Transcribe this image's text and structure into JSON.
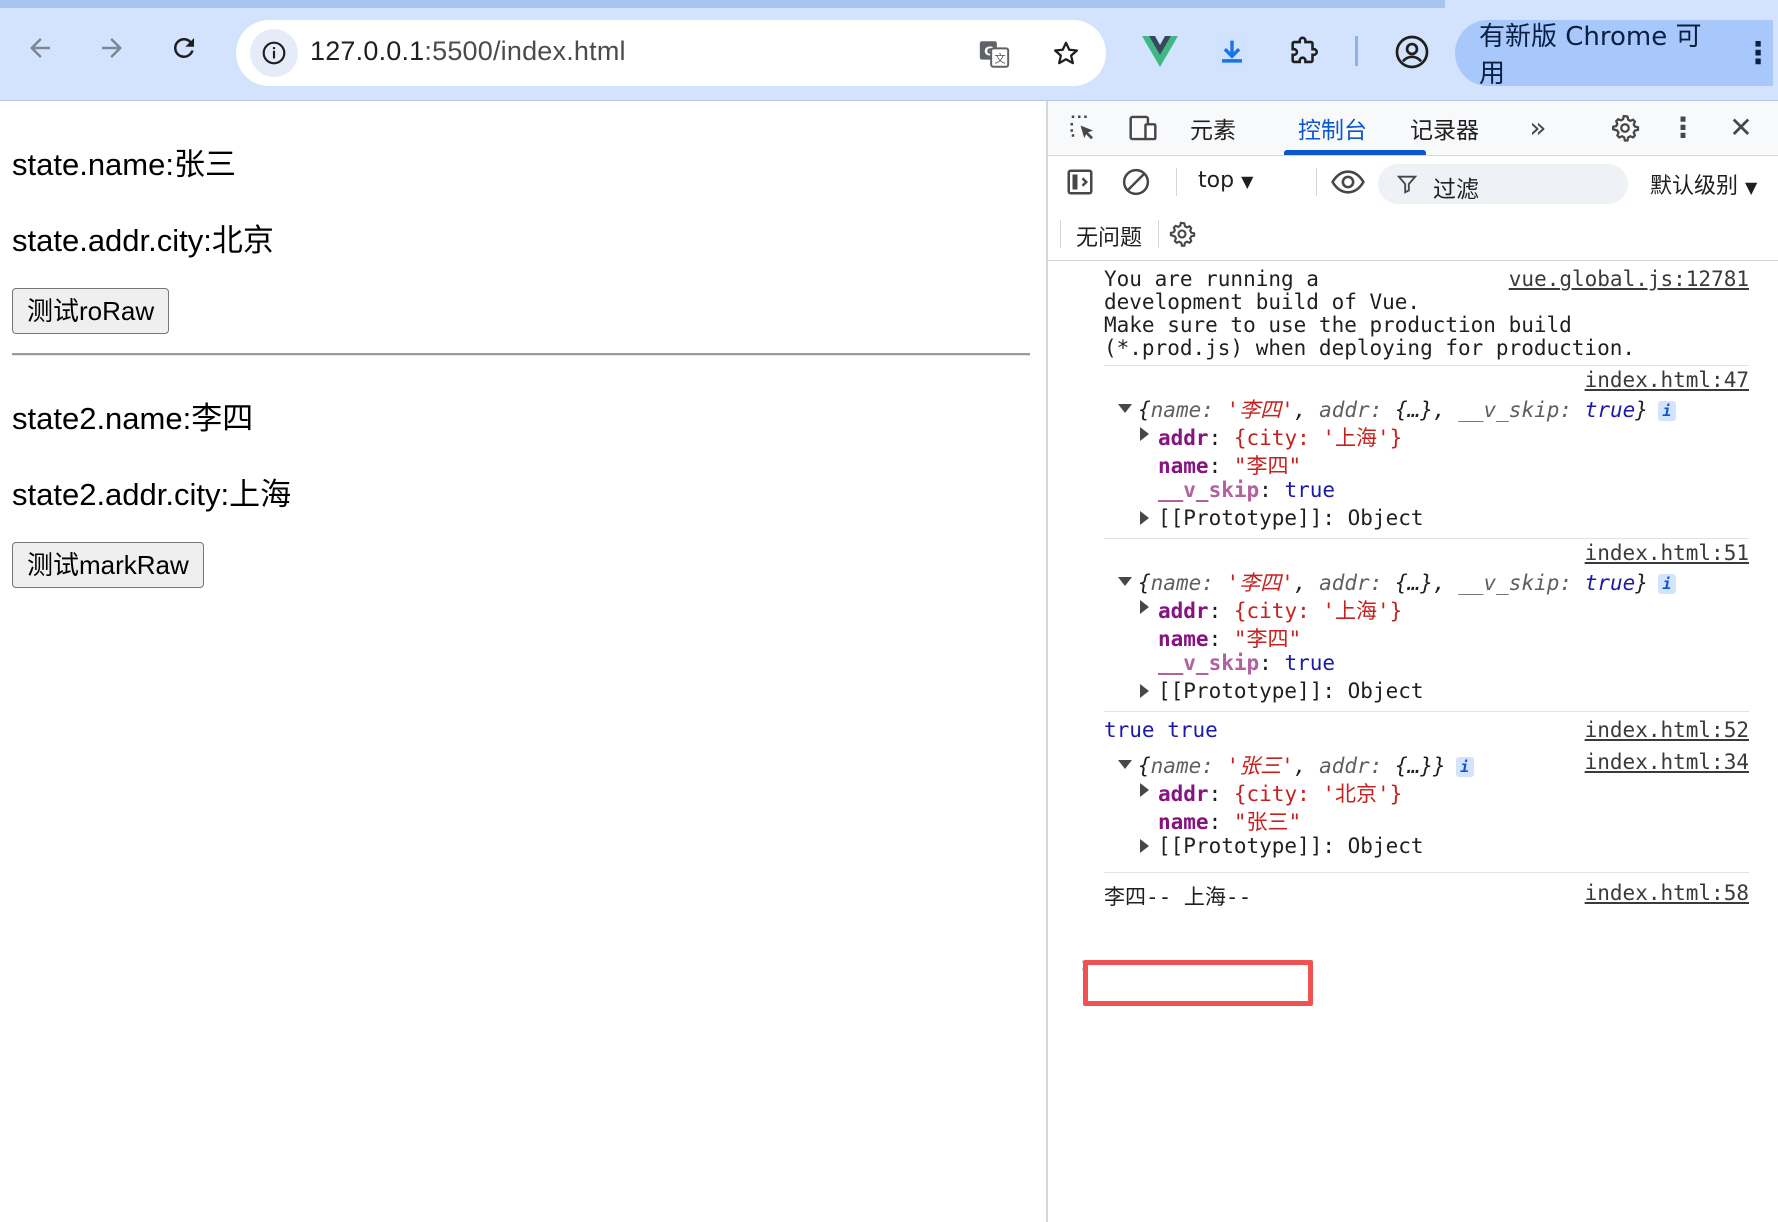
{
  "browser": {
    "url_host": "127.0.0.1",
    "url_rest": ":5500/index.html",
    "update_button": "有新版 Chrome 可用",
    "icons": {
      "back": "arrow-left-icon",
      "forward": "arrow-right-icon",
      "reload": "reload-icon",
      "site_info": "site-info-icon",
      "translate": "translate-icon",
      "bookmark": "star-icon",
      "vue_devtools": "vue-logo-icon",
      "download": "download-icon",
      "extensions": "puzzle-icon",
      "profile": "profile-icon",
      "menu": "kebab-menu-icon"
    }
  },
  "page": {
    "line1": "state.name:张三",
    "line2": "state.addr.city:北京",
    "button1": "测试roRaw",
    "line3": "state2.name:李四",
    "line4": "state2.addr.city:上海",
    "button2": "测试markRaw"
  },
  "devtools": {
    "tabs": [
      "元素",
      "控制台",
      "记录器"
    ],
    "active_tab": "控制台",
    "context": "top",
    "filter_placeholder": "过滤",
    "level": "默认级别",
    "issues": "无问题",
    "console": {
      "vue_warning": {
        "lines": [
          "You are running a",
          "development build of Vue.",
          "Make sure to use the production build",
          "(*.prod.js) when deploying for production."
        ],
        "source": "vue.global.js:12781"
      },
      "log1": {
        "source": "index.html:47",
        "summary_open": "{",
        "summary_name_key": "name",
        "summary_name_val": "'李四'",
        "summary_addr_key": "addr",
        "summary_addr_val": "{…}",
        "summary_skip_key": "__v_skip",
        "summary_skip_val": "true",
        "addr_line_key": "addr",
        "addr_line_val": "{city: '上海'}",
        "name_key": "name",
        "name_val": "\"李四\"",
        "skip_key": "__v_skip",
        "skip_val": "true",
        "proto": "[[Prototype]]: Object"
      },
      "log2": {
        "source": "index.html:51",
        "summary_name_val": "'李四'",
        "addr_line_val": "{city: '上海'}",
        "name_val": "\"李四\"",
        "skip_val": "true",
        "proto": "[[Prototype]]: Object"
      },
      "log3": {
        "text": "true true",
        "source": "index.html:52"
      },
      "log4": {
        "source": "index.html:34",
        "summary_name_val": "'张三'",
        "addr_line_val": "{city: '北京'}",
        "name_val": "\"张三\"",
        "proto": "[[Prototype]]: Object"
      },
      "log5": {
        "text": "李四-- 上海--",
        "source": "index.html:58"
      },
      "prompt": "›"
    }
  },
  "colors": {
    "accent": "#0b57d0",
    "toolbar_bg": "#d3e3fd",
    "update_pill": "#a8c7fa",
    "highlight": "#f05252",
    "string": "#c5221f",
    "key": "#881280"
  }
}
